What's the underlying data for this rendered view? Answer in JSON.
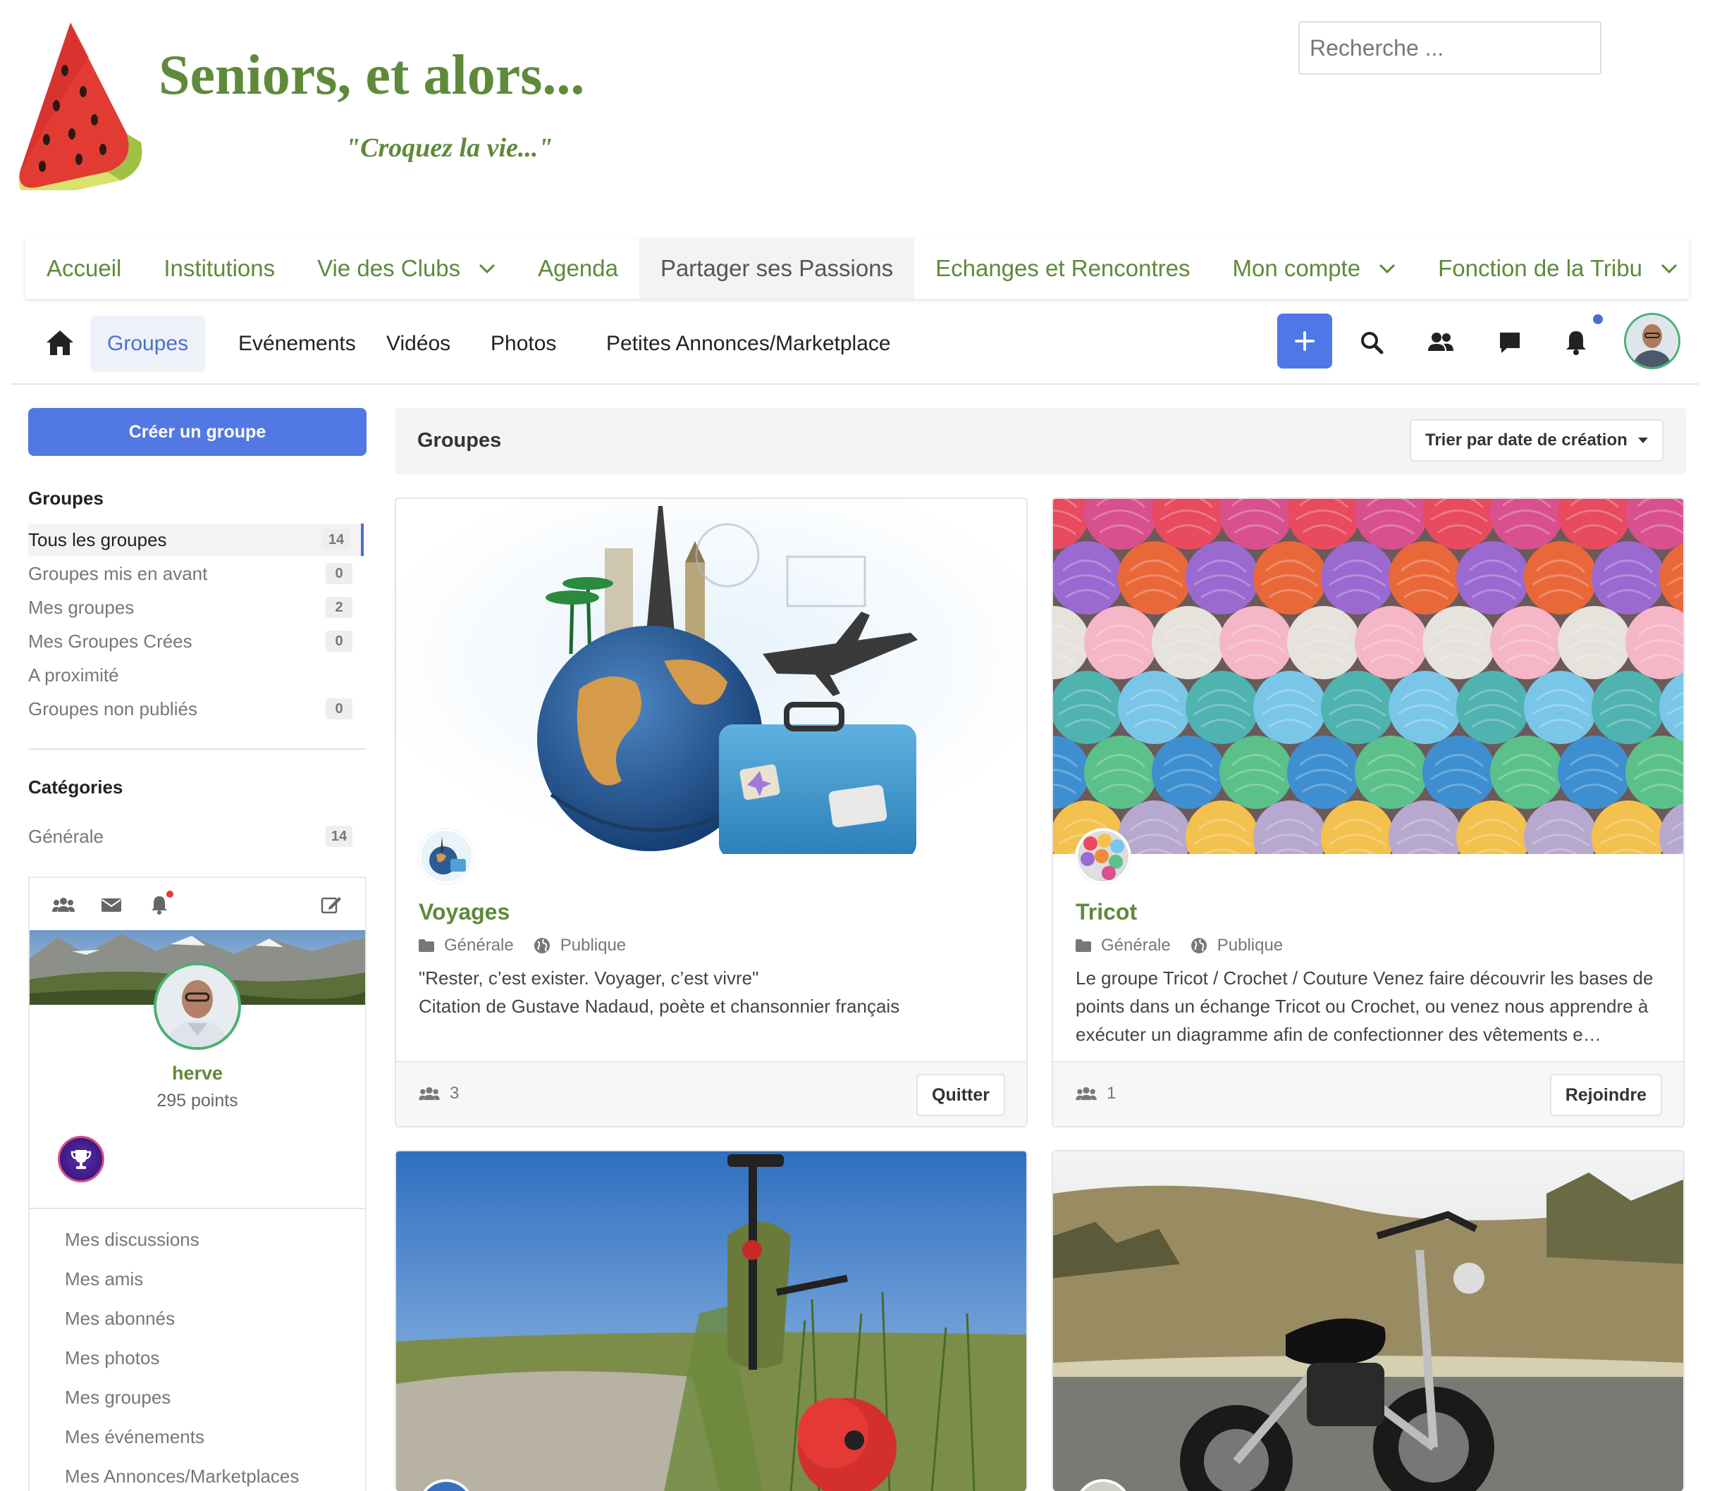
{
  "site": {
    "title": "Seniors, et alors...",
    "tagline": "\"Croquez la vie...\"",
    "logo_icon": "watermelon-slice-logo",
    "search_placeholder": "Recherche ..."
  },
  "main_menu": [
    {
      "label": "Accueil",
      "dropdown": false
    },
    {
      "label": "Institutions",
      "dropdown": false
    },
    {
      "label": "Vie des Clubs",
      "dropdown": true
    },
    {
      "label": "Agenda",
      "dropdown": false
    },
    {
      "label": "Partager ses Passions",
      "dropdown": false,
      "active": true
    },
    {
      "label": "Echanges et Rencontres",
      "dropdown": false
    },
    {
      "label": "Mon compte",
      "dropdown": true
    },
    {
      "label": "Fonction de la Tribu",
      "dropdown": true
    }
  ],
  "subnav": {
    "home_icon": "home-icon",
    "tabs": [
      "Groupes",
      "Evénements",
      "Vidéos",
      "Photos",
      "Petites Annonces/Marketplace"
    ],
    "active_tab": "Groupes",
    "action_icons": [
      "plus-icon",
      "search-icon",
      "friends-icon",
      "messages-icon",
      "bell-icon"
    ],
    "has_unread_notification": true
  },
  "sidebar": {
    "create_button": "Créer un groupe",
    "groups_heading": "Groupes",
    "filters": [
      {
        "label": "Tous les groupes",
        "count": "14",
        "active": true
      },
      {
        "label": "Groupes mis en avant",
        "count": "0"
      },
      {
        "label": "Mes groupes",
        "count": "2"
      },
      {
        "label": "Mes Groupes Crées",
        "count": "0"
      },
      {
        "label": "A proximité",
        "count": ""
      },
      {
        "label": "Groupes non publiés",
        "count": "0"
      }
    ],
    "categories_heading": "Catégories",
    "categories": [
      {
        "label": "Générale",
        "count": "14"
      }
    ],
    "profile": {
      "toolbar_icons": [
        "group-icon",
        "envelope-icon",
        "bell-icon",
        "edit-icon"
      ],
      "name": "herve",
      "points": "295 points",
      "badge_icon": "trophy-icon"
    },
    "profile_links": [
      "Mes discussions",
      "Mes amis",
      "Mes abonnés",
      "Mes photos",
      "Mes groupes",
      "Mes événements",
      "Mes Annonces/Marketplaces"
    ]
  },
  "main": {
    "title": "Groupes",
    "sort_label": "Trier par date de création",
    "groups": [
      {
        "title": "Voyages",
        "category": "Générale",
        "visibility": "Publique",
        "description": "\"Rester, c’est exister. Voyager, c’est vivre\"\nCitation de Gustave Nadaud, poète et chansonnier français",
        "members": "3",
        "action": "Quitter",
        "cover": "travel-globe-illustration"
      },
      {
        "title": "Tricot",
        "category": "Générale",
        "visibility": "Publique",
        "description": "Le groupe Tricot / Crochet / Couture Venez faire découvrir les bases de points dans un échange Tricot ou Crochet, ou venez nous apprendre à exécuter un diagramme afin de confectionner des vêtements e…",
        "members": "1",
        "action": "Rejoindre",
        "cover": "yarn-balls-photo"
      },
      {
        "cover": "bicycle-poppy-photo"
      },
      {
        "cover": "motorcycle-photo"
      }
    ]
  },
  "colors": {
    "brand_green": "#5e8a3a",
    "accent_blue": "#4f77e6",
    "notification_red": "#e53935"
  }
}
